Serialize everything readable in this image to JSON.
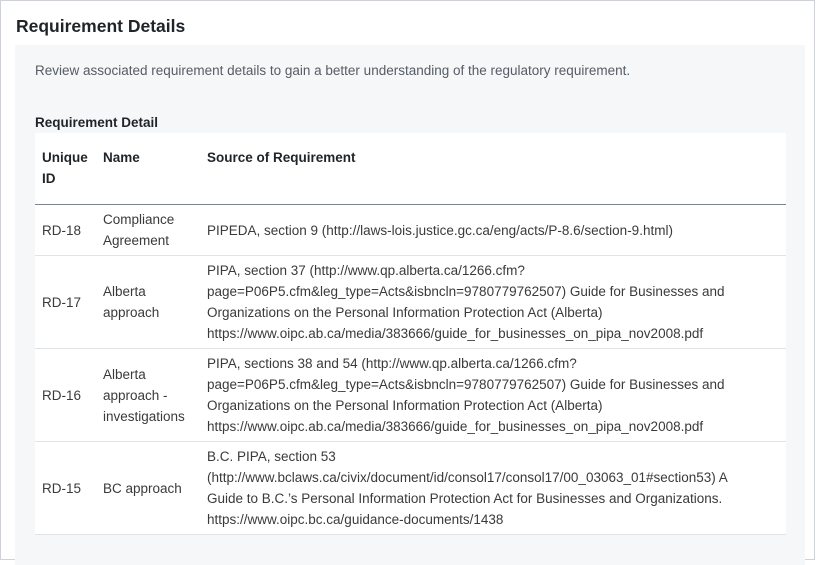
{
  "title": "Requirement Details",
  "description": "Review associated requirement details to gain a better understanding of the regulatory requirement.",
  "section_label": "Requirement Detail",
  "table": {
    "headers": [
      "Unique ID",
      "Name",
      "Source of Requirement"
    ],
    "rows": [
      {
        "id": "RD-18",
        "name": "Compliance Agreement",
        "source": "PIPEDA, section 9 (http://laws-lois.justice.gc.ca/eng/acts/P-8.6/section-9.html)"
      },
      {
        "id": "RD-17",
        "name": "Alberta approach",
        "source": "PIPA, section 37 (http://www.qp.alberta.ca/1266.cfm?\npage=P06P5.cfm&leg_type=Acts&isbncln=9780779762507) Guide for Businesses and\nOrganizations on the Personal Information Protection Act (Alberta)\nhttps://www.oipc.ab.ca/media/383666/guide_for_businesses_on_pipa_nov2008.pdf"
      },
      {
        "id": "RD-16",
        "name": "Alberta approach - investigations",
        "source": "PIPA, sections 38 and 54 (http://www.qp.alberta.ca/1266.cfm?\npage=P06P5.cfm&leg_type=Acts&isbncln=9780779762507) Guide for Businesses and\nOrganizations on the Personal Information Protection Act (Alberta)\nhttps://www.oipc.ab.ca/media/383666/guide_for_businesses_on_pipa_nov2008.pdf"
      },
      {
        "id": "RD-15",
        "name": "BC approach",
        "source": "B.C. PIPA, section 53\n(http://www.bclaws.ca/civix/document/id/consol17/consol17/00_03063_01#section53) A\nGuide to B.C.’s Personal Information Protection Act for Businesses and Organizations.\nhttps://www.oipc.bc.ca/guidance-documents/1438"
      }
    ]
  }
}
